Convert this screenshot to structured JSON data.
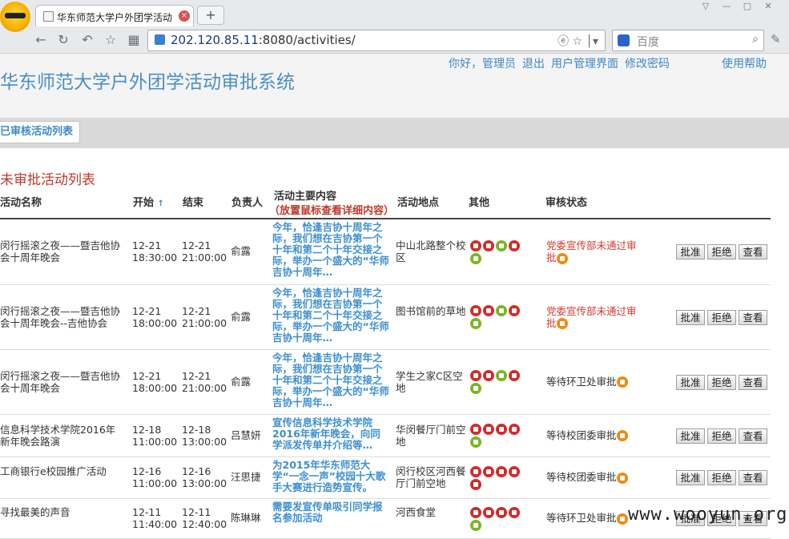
{
  "browser": {
    "tab_title": "华东师范大学户外团学活动",
    "tab_close": "×",
    "new_tab": "+",
    "url_host": "202.120.85.11",
    "url_rest": ":8080/activities/",
    "search_placeholder": "百度"
  },
  "header": {
    "site_title": "华东师范大学户外团学活动审批系统",
    "greeting": "你好，管理员",
    "logout": "退出",
    "user_mgmt": "用户管理界面",
    "change_pw": "修改密码",
    "help": "使用帮助"
  },
  "tabs": {
    "approved_list": "已审核活动列表"
  },
  "section_title": "未审批活动列表",
  "columns": {
    "name": "活动名称",
    "start": "开始",
    "sort_arrow": "↑",
    "end": "结束",
    "owner": "负责人",
    "content": "活动主要内容",
    "content_hint": "（放置鼠标查看详细内容）",
    "location": "活动地点",
    "other": "其他",
    "status": "审核状态"
  },
  "actions": {
    "approve": "批准",
    "reject": "拒绝",
    "view": "查看"
  },
  "rows": [
    {
      "name": "闵行摇滚之夜——暨吉他协会十周年晚会",
      "start_date": "12-21",
      "start_time": "18:30:00",
      "end_date": "12-21",
      "end_time": "21:00:00",
      "owner": "俞露",
      "content": "今年，恰逢吉协十周年之际，我们想在吉协第一个十年和第二个十年交接之际，举办一个盛大的“华师吉协十周年…",
      "location": "中山北路整个校区",
      "status": "党委宣传部未通过审批",
      "status_red": true
    },
    {
      "name": "闵行摇滚之夜——暨吉他协会十周年晚会--吉他协会",
      "start_date": "12-21",
      "start_time": "18:00:00",
      "end_date": "12-21",
      "end_time": "21:00:00",
      "owner": "俞露",
      "content": "今年，恰逢吉协十周年之际，我们想在吉协第一个十年和第二个十年交接之际，举办一个盛大的“华师吉协十周年…",
      "location": "图书馆前的草地",
      "status": "党委宣传部未通过审批",
      "status_red": true
    },
    {
      "name": "闵行摇滚之夜——暨吉他协会十周年晚会",
      "start_date": "12-21",
      "start_time": "18:00:00",
      "end_date": "12-21",
      "end_time": "21:00:00",
      "owner": "俞露",
      "content": "今年，恰逢吉协十周年之际，我们想在吉协第一个十年和第二个十年交接之际，举办一个盛大的“华师吉协十周年…",
      "location": "学生之家C区空地",
      "status": "等待环卫处审批",
      "status_red": false
    },
    {
      "name": "信息科学技术学院2016年新年晚会路演",
      "start_date": "12-18",
      "start_time": "11:00:00",
      "end_date": "12-18",
      "end_time": "13:00:00",
      "owner": "吕慧妍",
      "content": "宣传信息科学技术学院2016年新年晚会，向同学派发传单并介绍等…",
      "location": "华闵餐厅门前空地",
      "status": "等待校团委审批",
      "status_red": false
    },
    {
      "name": "工商银行e校园推广活动",
      "start_date": "12-16",
      "start_time": "11:00:00",
      "end_date": "12-16",
      "end_time": "13:00:00",
      "owner": "汪思捷",
      "content": "为2015年华东师范大学“一念一声”校园十大歌手大赛进行造势宣传。",
      "location": "闵行校区河西餐厅门前空地",
      "status": "等待校团委审批",
      "status_red": false
    },
    {
      "name": "寻找最美的声音",
      "start_date": "12-11",
      "start_time": "11:40:00",
      "end_date": "12-11",
      "end_time": "12:40:00",
      "owner": "陈琳琳",
      "content": "需要发宣传单吸引同学报名参加活动",
      "location": "河西食堂",
      "status": "等待环卫处审批",
      "status_red": false
    }
  ],
  "watermark": "www.wooyun.org"
}
